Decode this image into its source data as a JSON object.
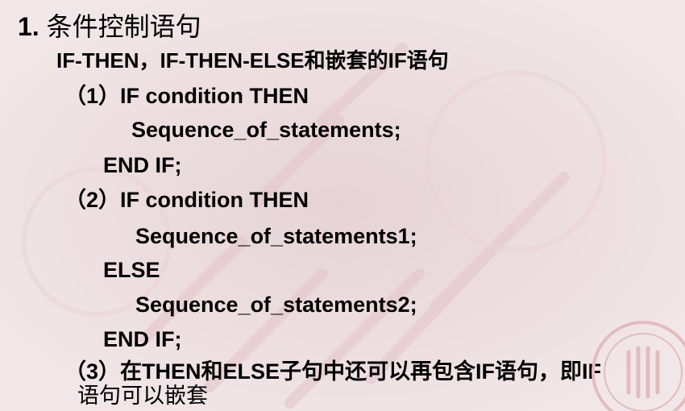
{
  "slide": {
    "title_number": "1.",
    "title_text": "条件控制语句",
    "subtitle": "IF-THEN，IF-THEN-ELSE和嵌套的IF语句",
    "lines": [
      "（1）IF condition THEN",
      "Sequence_of_statements;",
      "END IF;",
      "（2）IF condition THEN",
      "Sequence_of_statements1;",
      "ELSE",
      "Sequence_of_statements2;",
      "END IF;",
      "（3）在THEN和ELSE子句中还可以再包含IF语句，即IF",
      "语句可以嵌套"
    ]
  },
  "colors": {
    "background": "#efe2e4",
    "watermark": "#e7c9cf",
    "text": "#000000"
  }
}
